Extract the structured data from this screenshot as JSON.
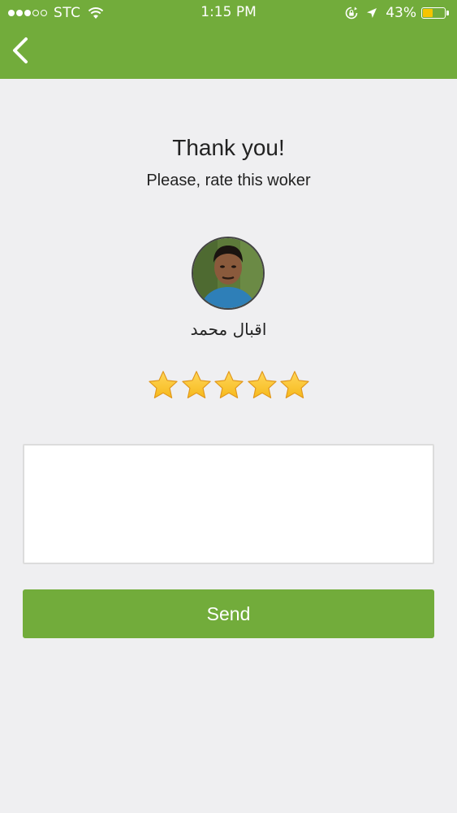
{
  "status_bar": {
    "carrier": "STC",
    "time": "1:15 PM",
    "battery_percent": "43%",
    "battery_level": 0.43,
    "signal_bars_full": 3,
    "signal_bars_total": 5
  },
  "header": {
    "back_icon": "chevron-left-icon"
  },
  "main": {
    "title": "Thank you!",
    "subtitle": "Please, rate this woker",
    "worker_name": "اقبال محمد",
    "rating": 5,
    "rating_max": 5,
    "comment_value": "",
    "send_label": "Send"
  },
  "colors": {
    "brand_green": "#72ac3b",
    "background": "#efeff1",
    "star_gold": "#f6b91c",
    "battery_yellow": "#f5c400"
  }
}
